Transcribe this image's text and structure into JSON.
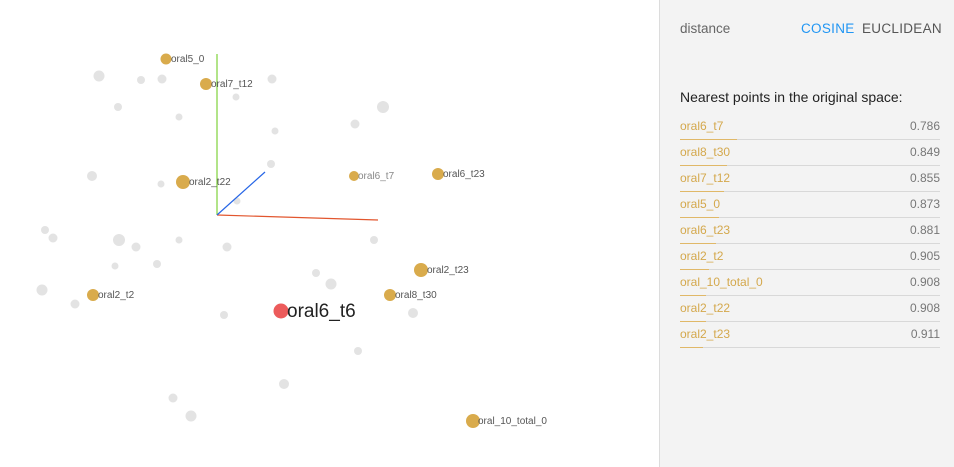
{
  "colors": {
    "neighbor": "#d9ab4c",
    "selected": "#ec5b5b",
    "background_point": "#e3e3e3",
    "axis_x": "#e2562e",
    "axis_y": "#7fd13b",
    "axis_z": "#2766e6",
    "accent": "#2196f3"
  },
  "panel": {
    "distance_label": "distance",
    "cosine_label": "COSINE",
    "euclidean_label": "EUCLIDEAN",
    "nearest_title": "Nearest points in the original space:",
    "neighbors": [
      {
        "name": "oral6_t7",
        "value": "0.786",
        "bar": 0.22
      },
      {
        "name": "oral8_t30",
        "value": "0.849",
        "bar": 0.18
      },
      {
        "name": "oral7_t12",
        "value": "0.855",
        "bar": 0.17
      },
      {
        "name": "oral5_0",
        "value": "0.873",
        "bar": 0.15
      },
      {
        "name": "oral6_t23",
        "value": "0.881",
        "bar": 0.14
      },
      {
        "name": "oral2_t2",
        "value": "0.905",
        "bar": 0.11
      },
      {
        "name": "oral_10_total_0",
        "value": "0.908",
        "bar": 0.1
      },
      {
        "name": "oral2_t22",
        "value": "0.908",
        "bar": 0.1
      },
      {
        "name": "oral2_t23",
        "value": "0.911",
        "bar": 0.09
      }
    ]
  },
  "scene": {
    "selected_label": "oral6_t6",
    "labeled_points": [
      "oral5_0",
      "oral7_t12",
      "oral2_t22",
      "oral6_t7",
      "oral6_t23",
      "oral2_t23",
      "oral8_t30",
      "oral2_t2",
      "oral_10_total_0"
    ]
  }
}
